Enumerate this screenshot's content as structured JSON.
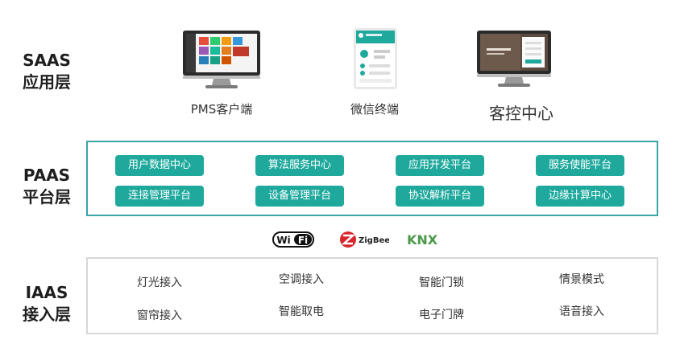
{
  "saas": {
    "label_line1": "SAAS",
    "label_line2": "应用层",
    "devices": [
      {
        "name": "PMS客户端",
        "icon": "desktop-monitor-icon"
      },
      {
        "name": "微信终端",
        "icon": "mobile-phone-icon"
      },
      {
        "name": "客控中心",
        "icon": "desktop-monitor-icon"
      }
    ]
  },
  "paas": {
    "label_line1": "PAAS",
    "label_line2": "平台层",
    "modules": [
      "用户数据中心",
      "算法服务中心",
      "应用开发平台",
      "服务使能平台",
      "连接管理平台",
      "设备管理平台",
      "协议解析平台",
      "边缘计算中心"
    ]
  },
  "protocols": {
    "wifi": "WiFi",
    "zigbee": "ZigBee",
    "knx": "KNX"
  },
  "iaas": {
    "label_line1": "IAAS",
    "label_line2": "接入层",
    "items": [
      "灯光接入",
      "空调接入",
      "智能门锁",
      "情景模式",
      "窗帘接入",
      "智能取电",
      "电子门牌",
      "语音接入"
    ]
  },
  "colors": {
    "accent": "#1fa99d",
    "paas_border": "#3aa5a5",
    "iaas_border": "#d8d8d8"
  }
}
